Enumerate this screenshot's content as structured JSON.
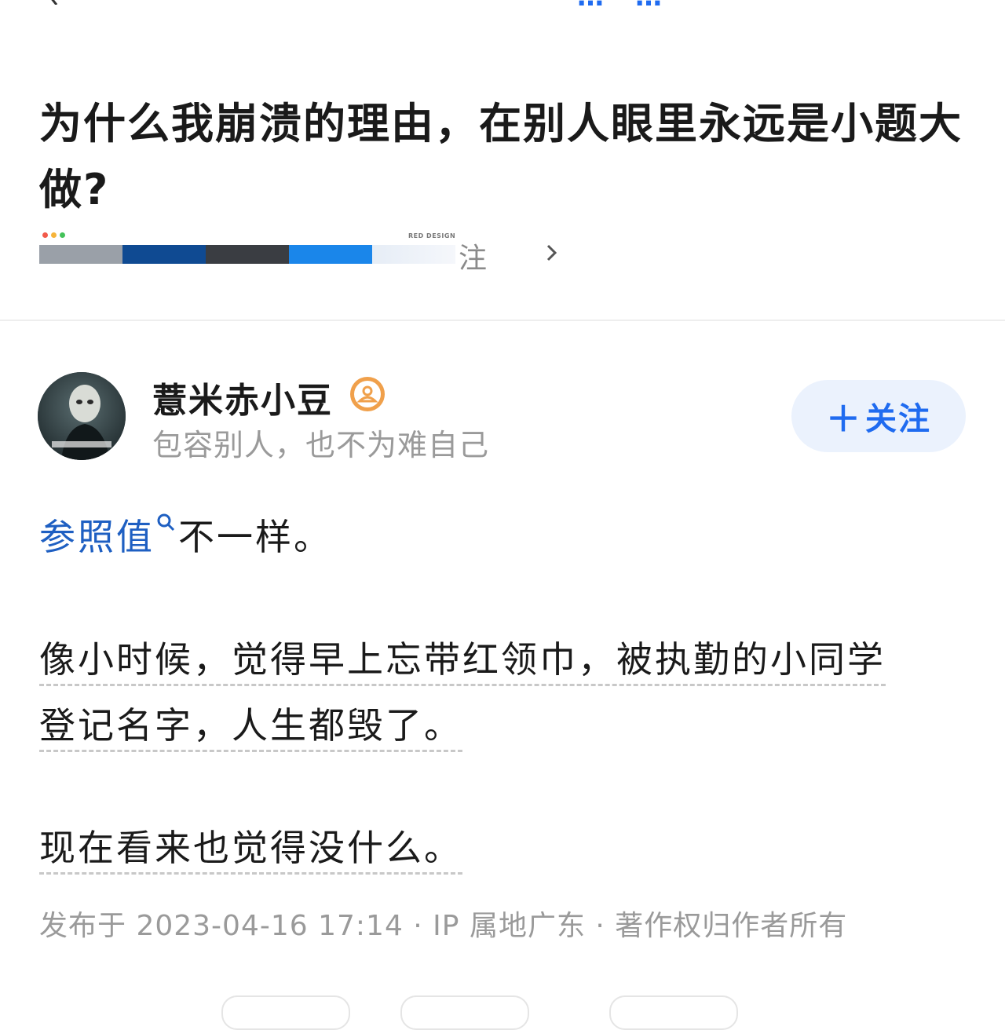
{
  "topbar": {
    "link_1": "…",
    "link_2": "…"
  },
  "question": {
    "title": "为什么我崩溃的理由，在别人眼里永远是小题大做?",
    "meta_follow": "注",
    "watermark": "RED DESIGN",
    "strip_colors": [
      "#9aa0a8",
      "#0f4a92",
      "#3a3d42",
      "#1a86ea",
      "#e8eef7"
    ]
  },
  "author": {
    "name": "薏米赤小豆",
    "bio": "包容别人，也不为难自己",
    "follow_label": "关注",
    "follow_plus": "＋"
  },
  "answer": {
    "term": "参照值",
    "line1_rest": "不一样。",
    "para2_line1": "像小时候，觉得早上忘带红领巾，被执勤的小同学",
    "para2_line2": "登记名字，人生都毁了。",
    "para3": "现在看来也觉得没什么。"
  },
  "footer": {
    "meta": "发布于 2023-04-16 17:14 · IP 属地广东 · 著作权归作者所有"
  },
  "colors": {
    "accent": "#1f6bf0",
    "link": "#1e5fc2",
    "muted": "#9a9a9a",
    "badge": "#f0a04b"
  }
}
